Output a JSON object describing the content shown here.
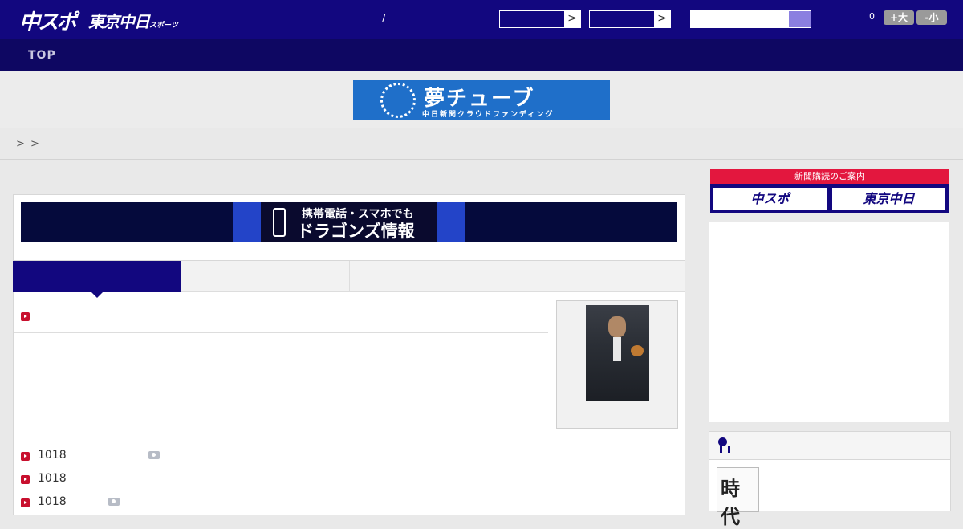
{
  "header": {
    "logo_chuspo": "中スポ",
    "logo_tokyo": "東京中日",
    "logo_tokyo_small": "スポーツ",
    "separator": "/",
    "select1_arrow": ">",
    "select2_arrow": ">",
    "font_count": "0",
    "font_larger": "+大",
    "font_smaller": "-小"
  },
  "nav": {
    "top_label": "TOP"
  },
  "banner": {
    "title": "夢チューブ",
    "subtitle": "中日新聞クラウドファンディング"
  },
  "breadcrumb": {
    "sep1": ">",
    "sep2": ">"
  },
  "mobile_ad": {
    "line1": "携帯電話・スマホでも",
    "line2": "ドラゴンズ情報"
  },
  "tabs": [
    {
      "label": ""
    },
    {
      "label": ""
    },
    {
      "label": ""
    },
    {
      "label": ""
    }
  ],
  "article_list": [
    {
      "text": "1018",
      "has_photo": true
    },
    {
      "text": "1018",
      "has_photo": false
    },
    {
      "text": "1018",
      "has_photo": true
    }
  ],
  "subscription": {
    "title": "新聞購読のご案内",
    "chuspo": "中スポ",
    "tokyo": "東京中日"
  },
  "ranking": {
    "thumb_text": "時代"
  },
  "colors": {
    "header_bg": "#12077f",
    "nav_bg": "#0e0762",
    "accent_red": "#c8102e",
    "subscribe_red": "#e3173e",
    "banner_blue": "#1f6fc9"
  }
}
